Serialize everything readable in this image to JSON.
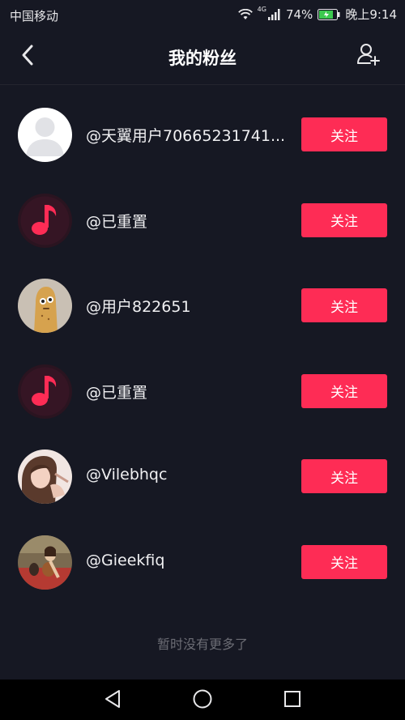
{
  "status_bar": {
    "carrier": "中国移动",
    "network": "4G",
    "battery": "74%",
    "time": "晚上9:14"
  },
  "nav": {
    "title": "我的粉丝"
  },
  "followers": [
    {
      "username": "@天翼用户70665231741...",
      "button": "关注",
      "avatar": "default-avatar-icon"
    },
    {
      "username": "@已重置",
      "button": "关注",
      "avatar": "music-note-icon"
    },
    {
      "username": "@用户822651",
      "button": "关注",
      "avatar": "cartoon-character-avatar"
    },
    {
      "username": "@已重置",
      "button": "关注",
      "avatar": "music-note-icon"
    },
    {
      "username": "@Vilebhqc",
      "button": "关注",
      "avatar": "girl-photo-avatar"
    },
    {
      "username": "@Gieekfiq",
      "button": "关注",
      "avatar": "dog-photo-avatar"
    }
  ],
  "footer_text": "暂时没有更多了",
  "colors": {
    "background": "#161823",
    "accent": "#fe2c55",
    "muted_text": "#6b6c74"
  }
}
